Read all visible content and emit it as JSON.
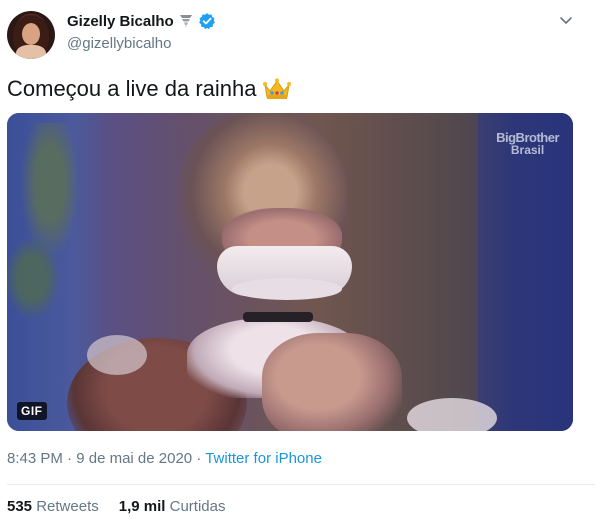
{
  "author": {
    "display_name": "Gizelly Bicalho",
    "handle": "@gizellybicalho",
    "badge_icon": "tornado-icon",
    "verified": true
  },
  "tweet": {
    "text": "Começou a live da rainha",
    "emoji": "crown-icon"
  },
  "media": {
    "type": "gif",
    "badge": "GIF",
    "watermark_line1": "BigBrother",
    "watermark_line2": "Brasil"
  },
  "meta": {
    "time": "8:43 PM",
    "separator": "·",
    "date": "9 de mai de 2020",
    "source": "Twitter for iPhone"
  },
  "stats": {
    "retweets_count": "535",
    "retweets_label": "Retweets",
    "likes_count": "1,9 mil",
    "likes_label": "Curtidas"
  },
  "colors": {
    "link": "#1b95e0",
    "muted": "#657786",
    "verified": "#1da1f2"
  }
}
